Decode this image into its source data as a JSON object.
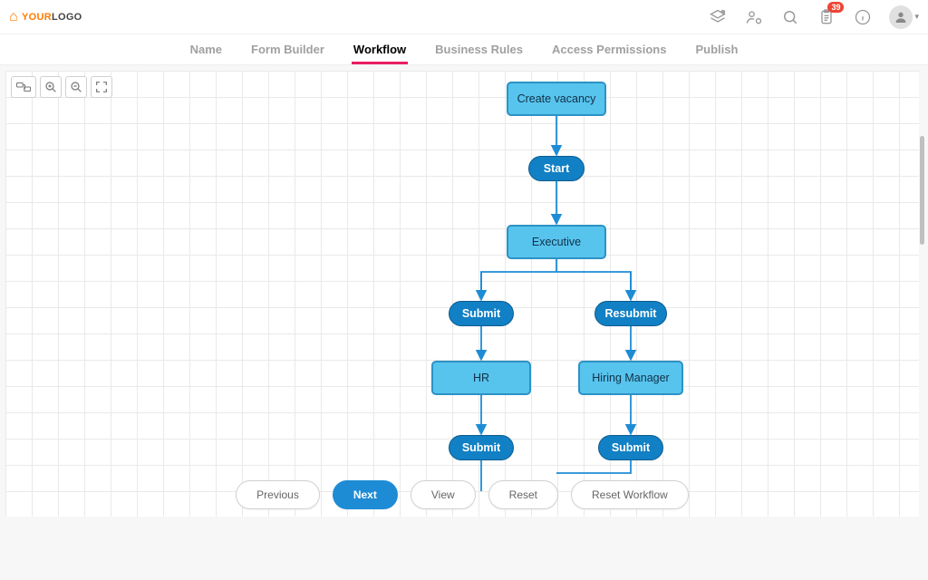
{
  "logo": {
    "text1": "YOUR",
    "text2": "LOGO"
  },
  "header": {
    "notifications_count": "39"
  },
  "tabs": [
    {
      "label": "Name",
      "active": false
    },
    {
      "label": "Form Builder",
      "active": false
    },
    {
      "label": "Workflow",
      "active": true
    },
    {
      "label": "Business Rules",
      "active": false
    },
    {
      "label": "Access Permissions",
      "active": false
    },
    {
      "label": "Publish",
      "active": false
    }
  ],
  "toolbar": {
    "step_tip": "step",
    "zoom_in_tip": "zoom-in",
    "zoom_out_tip": "zoom-out",
    "fullscreen_tip": "fullscreen"
  },
  "workflow": {
    "nodes": {
      "create_vacancy": "Create vacancy",
      "executive": "Executive",
      "hr": "HR",
      "hiring_manager": "Hiring Manager"
    },
    "transitions": {
      "start": "Start",
      "submit1": "Submit",
      "resubmit": "Resubmit",
      "submit_hr": "Submit",
      "submit_hm": "Submit"
    }
  },
  "footer": {
    "previous": "Previous",
    "next": "Next",
    "view": "View",
    "reset": "Reset",
    "reset_workflow": "Reset Workflow"
  }
}
